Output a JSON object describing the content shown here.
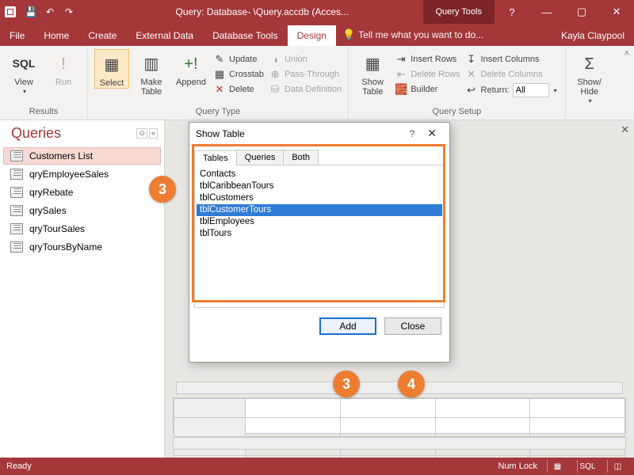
{
  "titlebar": {
    "title": "Query: Database- \\Query.accdb (Acces...",
    "context_tab": "Query Tools"
  },
  "winbuttons": {
    "help": "?",
    "min": "—",
    "max": "▢",
    "close": "✕"
  },
  "tabs": {
    "file": "File",
    "home": "Home",
    "create": "Create",
    "external": "External Data",
    "dbtools": "Database Tools",
    "design": "Design",
    "tell": "Tell me what you want to do...",
    "user": "Kayla Claypool"
  },
  "ribbon": {
    "groups": {
      "results": "Results",
      "querytype": "Query Type",
      "querysetup": "Query Setup",
      "showhide": ""
    },
    "results": {
      "view": "View",
      "run": "Run"
    },
    "qtype": {
      "select": "Select",
      "maketable": "Make\nTable",
      "append": "Append",
      "update": "Update",
      "crosstab": "Crosstab",
      "delete": "Delete",
      "union": "Union",
      "passthrough": "Pass-Through",
      "datadef": "Data Definition"
    },
    "setup": {
      "showtable": "Show\nTable",
      "insertrows": "Insert Rows",
      "deleterows": "Delete Rows",
      "builder": "Builder",
      "insertcols": "Insert Columns",
      "deletecols": "Delete Columns",
      "return": "Return:",
      "return_value": "All"
    },
    "showhide": {
      "showhide": "Show/\nHide"
    }
  },
  "nav": {
    "header": "Queries",
    "items": [
      {
        "label": "Customers List",
        "selected": true
      },
      {
        "label": "qryEmployeeSales"
      },
      {
        "label": "qryRebate"
      },
      {
        "label": "qrySales"
      },
      {
        "label": "qryTourSales"
      },
      {
        "label": "qryToursByName"
      }
    ]
  },
  "dialog": {
    "title": "Show Table",
    "tabs": {
      "tables": "Tables",
      "queries": "Queries",
      "both": "Both"
    },
    "items": [
      "Contacts",
      "tblCaribbeanTours",
      "tblCustomers",
      "tblCustomerTours",
      "tblEmployees",
      "tblTours"
    ],
    "selected_index": 3,
    "add": "Add",
    "close": "Close"
  },
  "status": {
    "ready": "Ready",
    "numlock": "Num Lock",
    "sql": "SQL"
  },
  "callouts": {
    "c1": "3",
    "c2": "3",
    "c3": "4"
  }
}
